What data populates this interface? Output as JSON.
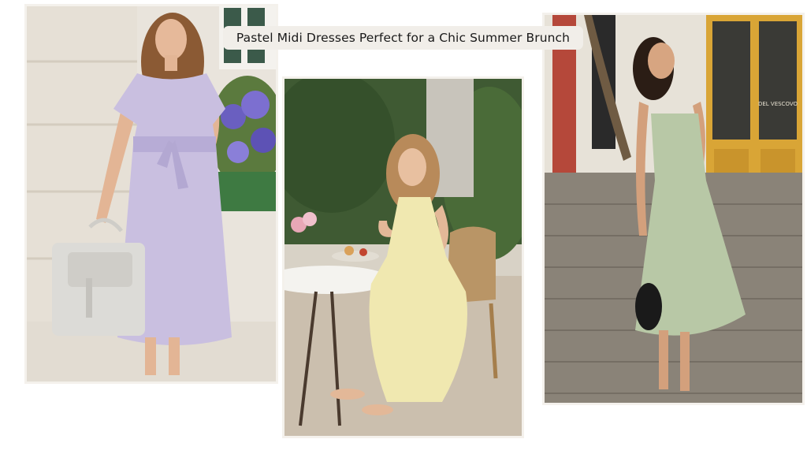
{
  "caption": {
    "text": "Pastel Midi Dresses Perfect for a Chic Summer Brunch"
  },
  "photos": [
    {
      "dress_color": "#c9bfe0",
      "bag_color": "#dcdbd7"
    },
    {
      "dress_color": "#f0e8b0",
      "chair_color": "#b99566"
    },
    {
      "dress_color": "#b8c8a6",
      "bag_color": "#1a1a1a"
    }
  ],
  "storefront_sign": {
    "text": "DEL VESCOVO"
  }
}
